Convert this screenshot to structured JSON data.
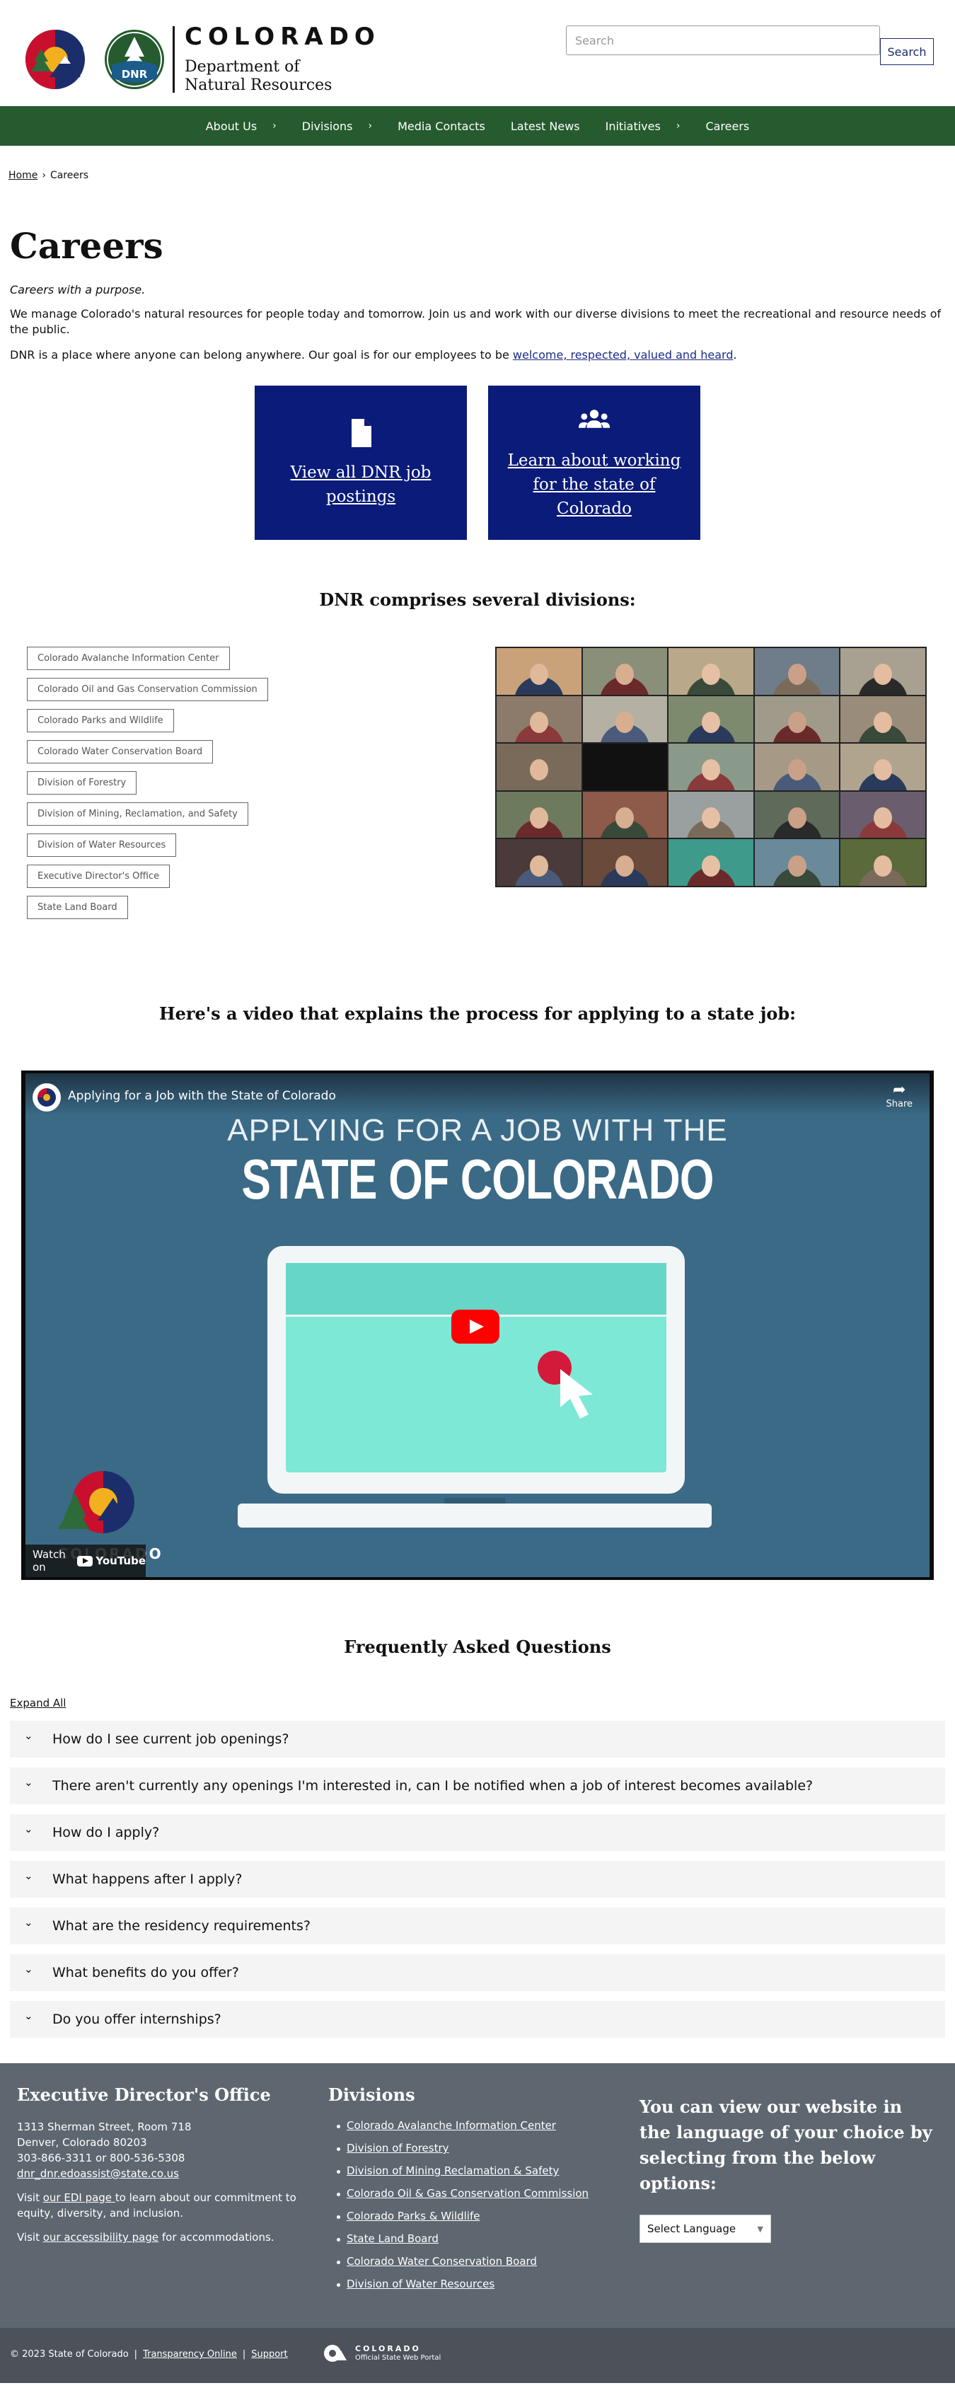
{
  "header": {
    "state_name": "COLORADO",
    "dept_line1": "Department of",
    "dept_line2": "Natural Resources",
    "dnr_badge": "DNR",
    "search_placeholder": "Search",
    "search_button": "Search"
  },
  "nav": {
    "items": [
      {
        "label": "About Us",
        "has_dropdown": true
      },
      {
        "label": "Divisions",
        "has_dropdown": true
      },
      {
        "label": "Media Contacts",
        "has_dropdown": false
      },
      {
        "label": "Latest News",
        "has_dropdown": false
      },
      {
        "label": "Initiatives",
        "has_dropdown": true
      },
      {
        "label": "Careers",
        "has_dropdown": false
      }
    ],
    "background": "#255b2e"
  },
  "breadcrumb": {
    "home": "Home",
    "separator": "›",
    "current": "Careers"
  },
  "main": {
    "title": "Careers",
    "tagline": "Careers with a purpose.",
    "intro1": "We manage Colorado's natural resources for people today and tomorrow. Join us and work with our diverse divisions to meet the recreational and resource needs of the public.",
    "intro2_before": "DNR is a place where anyone can belong anywhere. Our goal is for our employees to be ",
    "intro2_link": "welcome, respected, valued and heard",
    "intro2_after": ".",
    "cta_cards": [
      {
        "label": "View all DNR job postings",
        "icon": "document-icon"
      },
      {
        "label": "Learn about working for the state of Colorado",
        "icon": "people-group-icon"
      }
    ],
    "cta_color": "#0a1b7a",
    "divisions_heading": "DNR comprises several divisions:",
    "divisions": [
      "Colorado Avalanche Information Center",
      "Colorado Oil and Gas Conservation Commission",
      "Colorado Parks and Wildlife",
      "Colorado Water Conservation Board",
      "Division of Forestry",
      "Division of Mining, Reclamation, and Safety",
      "Division of Water Resources",
      "Executive Director's Office",
      "State Land Board"
    ],
    "video_heading": "Here's a video that explains the process for applying to a state job:",
    "video": {
      "title": "Applying for a Job with the State of Colorado",
      "share": "Share",
      "line1": "APPLYING FOR A JOB WITH THE",
      "line2": "STATE OF COLORADO",
      "watermark": "COLORADO",
      "watch_on": "Watch on",
      "youtube": "YouTube"
    },
    "faq_heading": "Frequently Asked Questions",
    "expand_all": "Expand All",
    "faqs": [
      "How do I see current job openings?",
      "There aren't currently any openings I'm interested in, can I be notified when a job of interest becomes available?",
      "How do I apply?",
      "What happens after I apply?",
      "What are the residency requirements?",
      "What benefits do you offer?",
      "Do you offer internships?"
    ]
  },
  "footer": {
    "edo_title": "Executive Director's Office",
    "address1": "1313 Sherman Street, Room 718",
    "address2": "Denver, Colorado 80203",
    "phone": "303-866-3311 or 800-536-5308",
    "email": "dnr_dnr.edoassist@state.co.us",
    "edi_before": "Visit ",
    "edi_link": "our EDI page ",
    "edi_after": "to learn about our commitment to equity, diversity, and inclusion.",
    "access_before": "Visit ",
    "access_link": "our accessibility page",
    "access_after": " for accommodations.",
    "divisions_title": "Divisions",
    "division_links": [
      "Colorado Avalanche Information Center",
      "Division of Forestry",
      "Division of Mining Reclamation & Safety",
      "Colorado Oil & Gas Conservation Commission",
      "Colorado Parks & Wildlife",
      "State Land Board",
      "Colorado Water Conservation Board",
      "Division of Water Resources"
    ],
    "language_heading": "You can view our website in the language of your choice by selecting from the below options:",
    "language_select": "Select Language",
    "background": "#5e6770"
  },
  "subfooter": {
    "copyright": "© 2023 State of Colorado",
    "transparency": "Transparency Online",
    "support": "Support",
    "portal_name": "COLORADO",
    "portal_sub": "Official State Web Portal"
  }
}
